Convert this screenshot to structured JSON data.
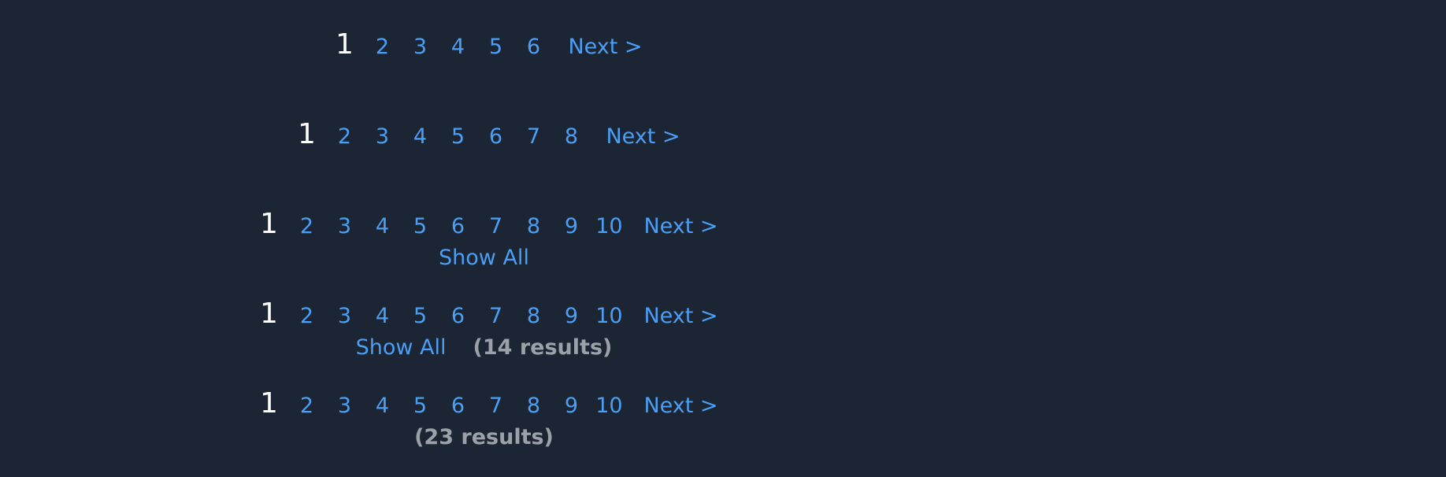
{
  "pagers": [
    {
      "current": "1",
      "pages": [
        "2",
        "3",
        "4",
        "5",
        "6"
      ],
      "next_label": "Next >"
    },
    {
      "current": "1",
      "pages": [
        "2",
        "3",
        "4",
        "5",
        "6",
        "7",
        "8"
      ],
      "next_label": "Next >"
    },
    {
      "current": "1",
      "pages": [
        "2",
        "3",
        "4",
        "5",
        "6",
        "7",
        "8",
        "9",
        "10"
      ],
      "next_label": "Next >",
      "show_all_label": "Show All"
    },
    {
      "current": "1",
      "pages": [
        "2",
        "3",
        "4",
        "5",
        "6",
        "7",
        "8",
        "9",
        "10"
      ],
      "next_label": "Next >",
      "show_all_label": "Show All",
      "results_label": "(14 results)"
    },
    {
      "current": "1",
      "pages": [
        "2",
        "3",
        "4",
        "5",
        "6",
        "7",
        "8",
        "9",
        "10"
      ],
      "next_label": "Next >",
      "results_label": "(23 results)"
    }
  ],
  "colors": {
    "background": "#1c2533",
    "link": "#4a9ff5",
    "current": "#ffffff",
    "results": "#9aa1a9"
  }
}
